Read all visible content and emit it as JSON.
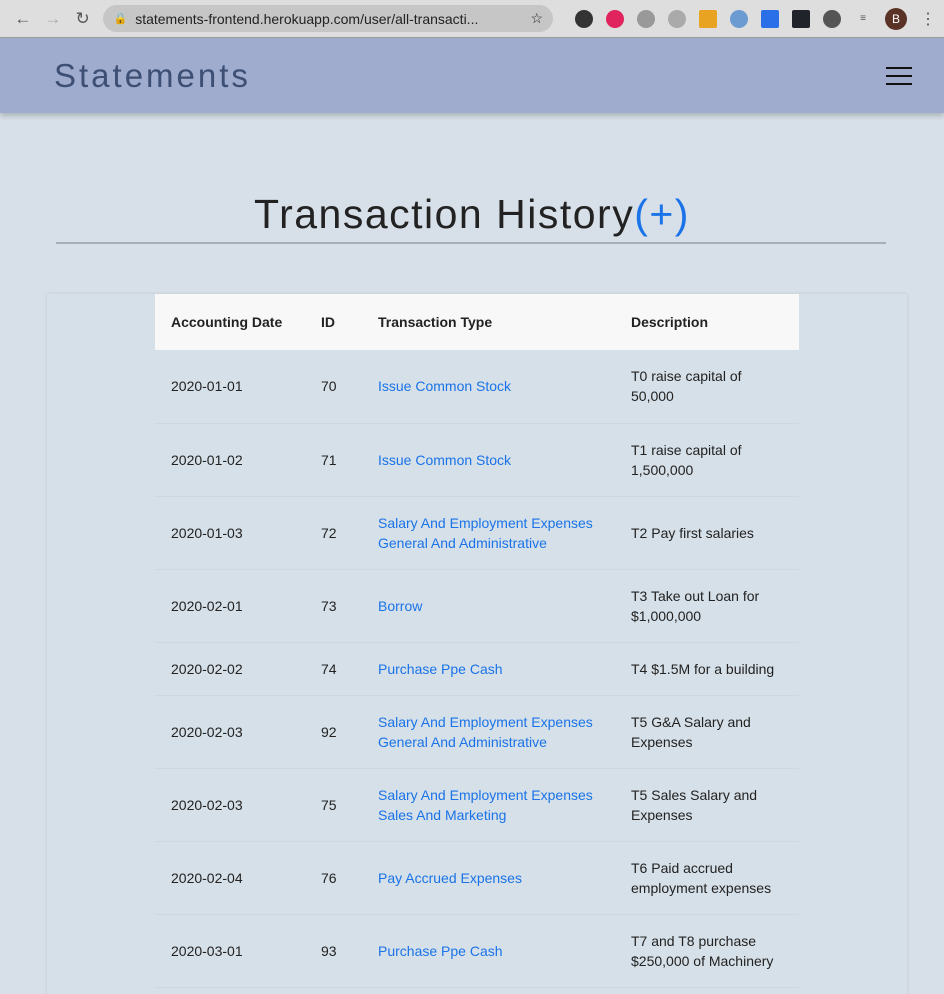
{
  "browser": {
    "url": "statements-frontend.herokuapp.com/user/all-transacti...",
    "profile_initial": "B"
  },
  "app": {
    "brand": "Statements"
  },
  "page": {
    "title": "Transaction History",
    "add_label": "(+)"
  },
  "table": {
    "headers": [
      "Accounting Date",
      "ID",
      "Transaction Type",
      "Description"
    ],
    "rows": [
      {
        "date": "2020-01-01",
        "id": "70",
        "type": [
          "Issue Common Stock"
        ],
        "desc": "T0 raise capital of 50,000"
      },
      {
        "date": "2020-01-02",
        "id": "71",
        "type": [
          "Issue Common Stock"
        ],
        "desc": "T1 raise capital of 1,500,000"
      },
      {
        "date": "2020-01-03",
        "id": "72",
        "type": [
          "Salary And Employment Expenses",
          "General And Administrative"
        ],
        "desc": "T2 Pay first salaries"
      },
      {
        "date": "2020-02-01",
        "id": "73",
        "type": [
          "Borrow"
        ],
        "desc": "T3 Take out Loan for $1,000,000"
      },
      {
        "date": "2020-02-02",
        "id": "74",
        "type": [
          "Purchase Ppe Cash"
        ],
        "desc": "T4 $1.5M for a building"
      },
      {
        "date": "2020-02-03",
        "id": "92",
        "type": [
          "Salary And Employment Expenses",
          "General And Administrative"
        ],
        "desc": "T5 G&A Salary and Expenses"
      },
      {
        "date": "2020-02-03",
        "id": "75",
        "type": [
          "Salary And Employment Expenses",
          "Sales And Marketing"
        ],
        "desc": "T5 Sales Salary and Expenses"
      },
      {
        "date": "2020-02-04",
        "id": "76",
        "type": [
          "Pay Accrued Expenses"
        ],
        "desc": "T6 Paid accrued employment expenses"
      },
      {
        "date": "2020-03-01",
        "id": "93",
        "type": [
          "Purchase Ppe Cash"
        ],
        "desc": "T7 and T8 purchase $250,000 of Machinery"
      }
    ]
  }
}
